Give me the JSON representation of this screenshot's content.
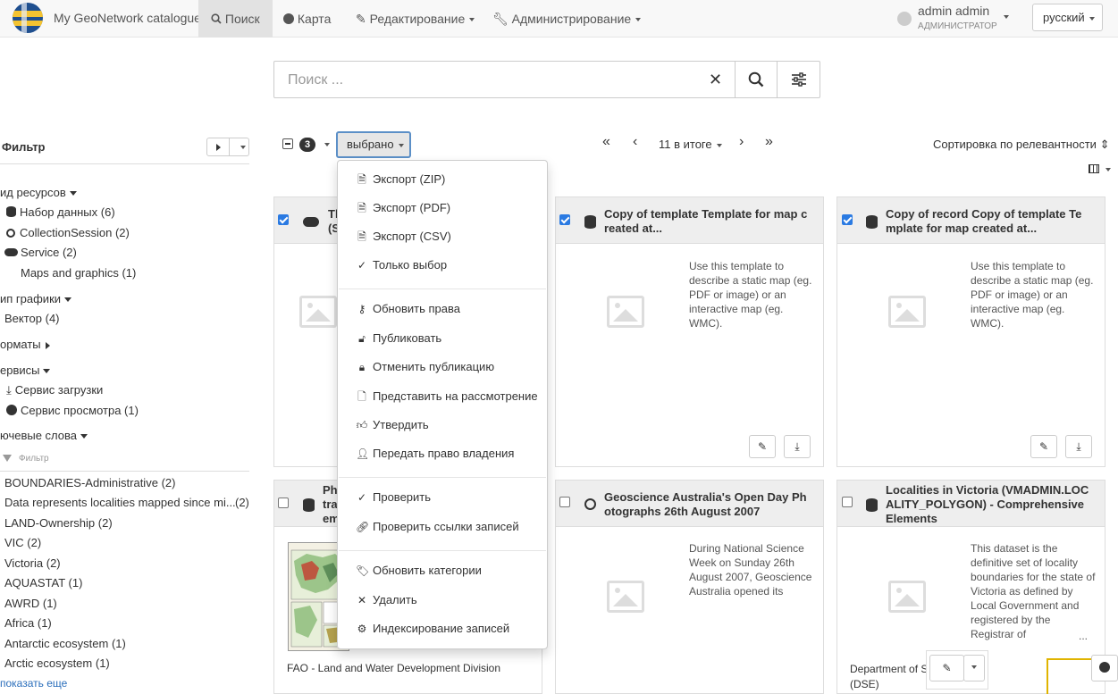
{
  "topbar": {
    "brand": "My GeoNetwork catalogue",
    "nav": [
      {
        "label": "Поиск"
      },
      {
        "label": "Карта"
      },
      {
        "label": "Редактирование"
      },
      {
        "label": "Администрирование"
      }
    ],
    "user_name": "admin admin",
    "user_role": "АДМИНИСТРАТОР",
    "language": "русский"
  },
  "search": {
    "placeholder": "Поиск ...",
    "clear": "✕"
  },
  "filter": {
    "title": "Фильтр",
    "facets": {
      "resource_type": {
        "label": "ид ресурсов",
        "items": [
          "Набор данных (6)",
          "CollectionSession (2)",
          "Service (2)",
          "Maps and graphics (1)"
        ]
      },
      "graphics_type": {
        "label": "ип графики",
        "items": [
          "Вектор (4)"
        ]
      },
      "formats": {
        "label": "орматы"
      },
      "services": {
        "label": "ервисы",
        "items": [
          "Сервис загрузки",
          "Сервис просмотра (1)"
        ]
      },
      "keywords": {
        "label": "ючевые слова",
        "filter_placeholder": "Фильтр",
        "items": [
          {
            "name": "BOUNDARIES-Administrative",
            "count": "(2)"
          },
          {
            "name": "Data represents localities mapped since mi...",
            "count": "(2)"
          },
          {
            "name": "LAND-Ownership",
            "count": "(2)"
          },
          {
            "name": "VIC",
            "count": "(2)"
          },
          {
            "name": "Victoria",
            "count": "(2)"
          },
          {
            "name": "AQUASTAT",
            "count": "(1)"
          },
          {
            "name": "AWRD",
            "count": "(1)"
          },
          {
            "name": "Africa",
            "count": "(1)"
          },
          {
            "name": "Antarctic ecosystem",
            "count": "(1)"
          },
          {
            "name": "Arctic ecosystem",
            "count": "(1)"
          }
        ],
        "show_more": "показать еще"
      }
    }
  },
  "toolbar": {
    "selected_count": "3",
    "selected_label": "выбрано",
    "total": "11 в итоге",
    "sort": "Сортировка по релевантности"
  },
  "menu": {
    "group1": [
      "Экспорт (ZIP)",
      "Экспорт (PDF)",
      "Экспорт (CSV)",
      "Только выбор"
    ],
    "group2": [
      "Обновить права",
      "Публиковать",
      "Отменить публикацию",
      "Представить на рассмотрение",
      "Утвердить",
      "Передать право владения"
    ],
    "group3": [
      "Проверить",
      "Проверить ссылки записей"
    ],
    "group4": [
      "Обновить категории",
      "Удалить",
      "Индексирование записей"
    ]
  },
  "cards": [
    {
      "title": "Th\n(S"
    },
    {
      "title": "Copy of template Template for map c reated at...",
      "desc": "Use this template to describe a static map (eg. PDF or image) or an interactive map (eg. WMC)."
    },
    {
      "title": "Copy of record Copy of template Te mplate for map created at...",
      "desc": "Use this template to describe a static map (eg. PDF or image) or an interactive map (eg. WMC)."
    },
    {
      "title": "Ph\ntra\nem",
      "footer": "FAO - Land and Water Development Division"
    },
    {
      "title": "Geoscience Australia's Open Day Ph otographs 26th August 2007",
      "desc": "During National Science Week on Sunday 26th August 2007, Geoscience Australia opened its"
    },
    {
      "title": "Localities in Victoria (VMADMIN.LOC ALITY_POLYGON) - Comprehensive Elements",
      "desc": "This dataset is the definitive set of locality boundaries for the state of Victoria as defined by Local Government and registered by the Registrar of",
      "ellipsis": "...",
      "footer": "Department of S\n(DSE)"
    }
  ]
}
